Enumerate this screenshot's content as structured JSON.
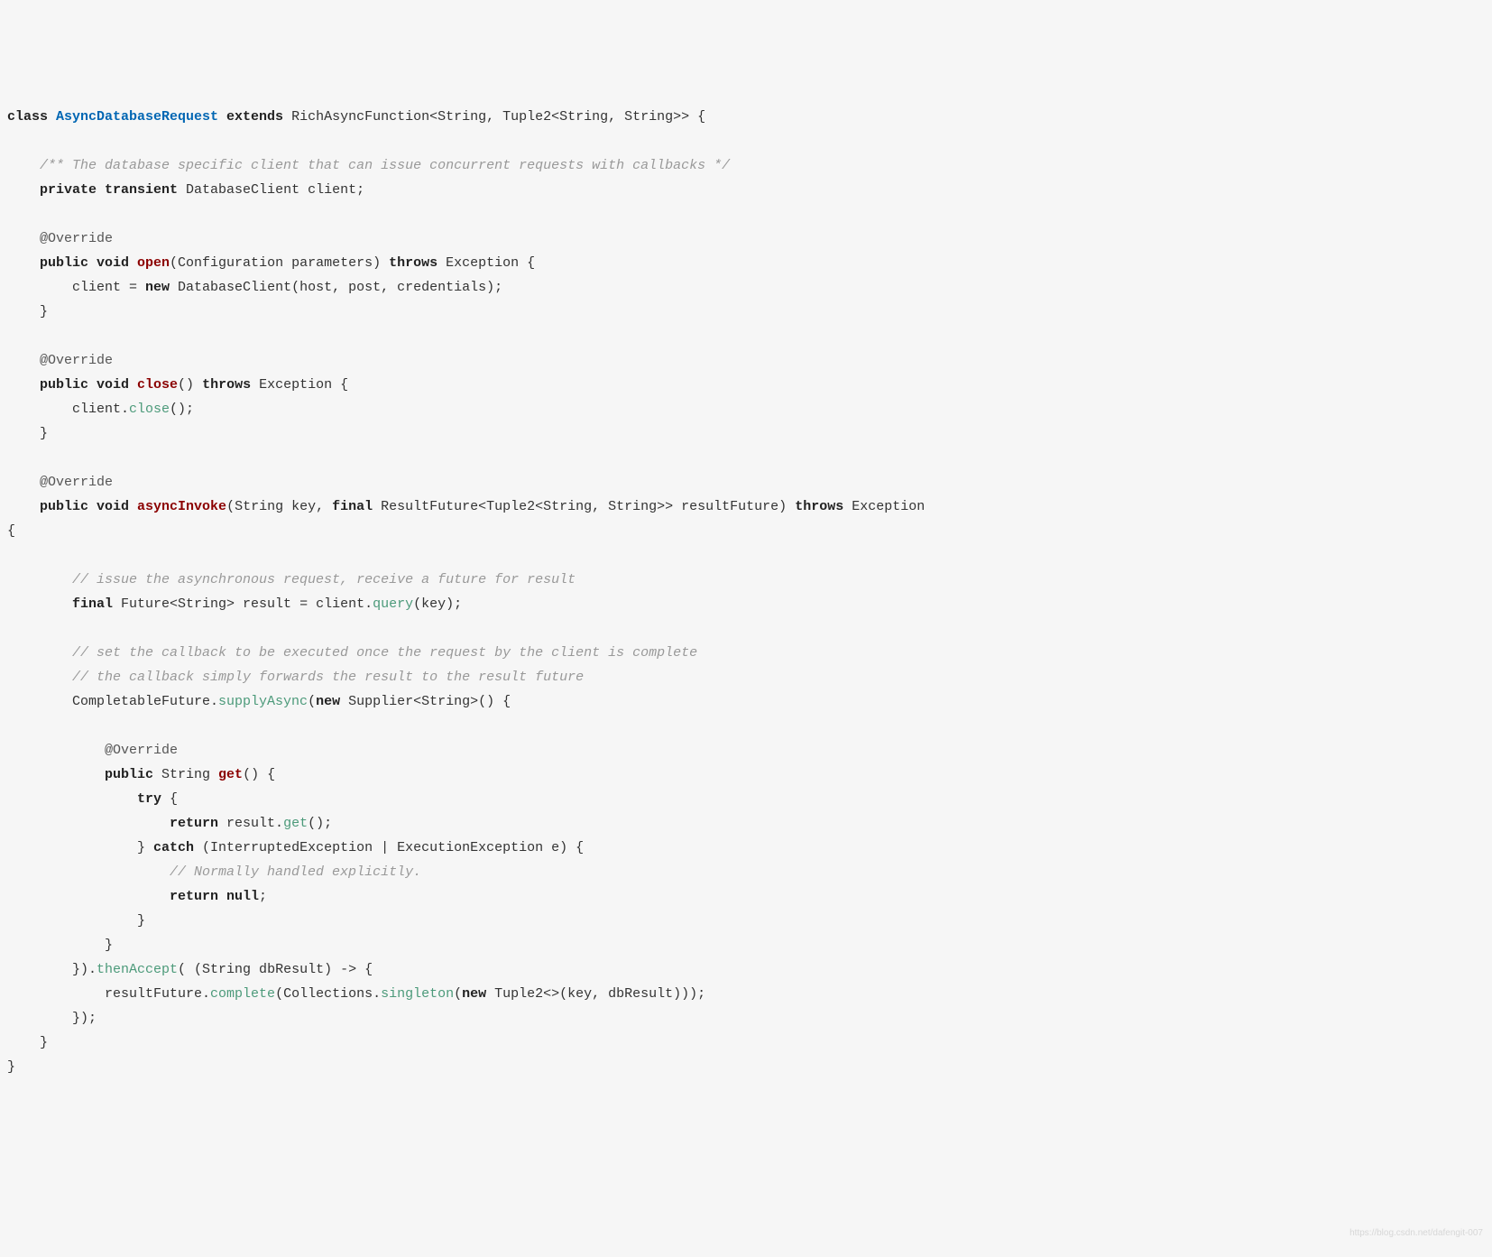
{
  "code": {
    "l0a": "class ",
    "l0b": "AsyncDatabaseRequest",
    "l0c": " extends ",
    "l0d": "RichAsyncFunction<String, Tuple2<String, String>> {",
    "blank": "",
    "l1": "    /** The database specific client that can issue concurrent requests with callbacks */",
    "l2a": "    private transient ",
    "l2b": "DatabaseClient client;",
    "l3": "    @Override",
    "l4a": "    public void ",
    "l4b": "open",
    "l4c": "(Configuration parameters) ",
    "l4d": "throws ",
    "l4e": "Exception {",
    "l5a": "        client = ",
    "l5b": "new ",
    "l5c": "DatabaseClient(host, post, credentials);",
    "l6": "    }",
    "l7a": "    public void ",
    "l7b": "close",
    "l7c": "() ",
    "l7d": "throws ",
    "l7e": "Exception {",
    "l8a": "        client.",
    "l8b": "close",
    "l8c": "();",
    "l9a": "    public void ",
    "l9b": "asyncInvoke",
    "l9c": "(String key, ",
    "l9d": "final ",
    "l9e": "ResultFuture<Tuple2<String, String>> resultFuture) ",
    "l9f": "throws ",
    "l9g": "Exception ",
    "l9h": "{",
    "l10": "        // issue the asynchronous request, receive a future for result",
    "l11a": "        final ",
    "l11b": "Future<String> result = client.",
    "l11c": "query",
    "l11d": "(key);",
    "l12": "        // set the callback to be executed once the request by the client is complete",
    "l13": "        // the callback simply forwards the result to the result future",
    "l14a": "        CompletableFuture.",
    "l14b": "supplyAsync",
    "l14c": "(",
    "l14d": "new ",
    "l14e": "Supplier<String>() {",
    "l15": "            @Override",
    "l16a": "            public ",
    "l16b": "String ",
    "l16c": "get",
    "l16d": "() {",
    "l17a": "                try ",
    "l17b": "{",
    "l18a": "                    return ",
    "l18b": "result.",
    "l18c": "get",
    "l18d": "();",
    "l19a": "                } ",
    "l19b": "catch ",
    "l19c": "(InterruptedException | ExecutionException e) {",
    "l20": "                    // Normally handled explicitly.",
    "l21a": "                    return null",
    "l21b": ";",
    "l22": "                }",
    "l23": "            }",
    "l24a": "        }).",
    "l24b": "thenAccept",
    "l24c": "( (String dbResult) -> {",
    "l25a": "            resultFuture.",
    "l25b": "complete",
    "l25c": "(Collections.",
    "l25d": "singleton",
    "l25e": "(",
    "l25f": "new ",
    "l25g": "Tuple2<>(key, dbResult)));",
    "l26": "        });",
    "l27": "    }",
    "l28": "}"
  },
  "watermark": "https://blog.csdn.net/dafengit-007"
}
